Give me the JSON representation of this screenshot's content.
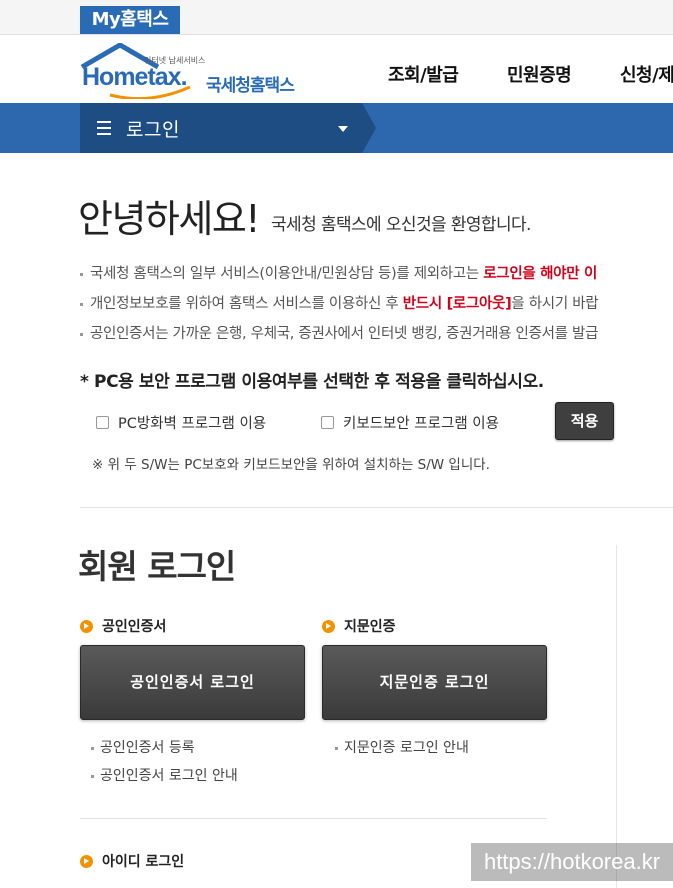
{
  "topbar": {
    "my_tab": "My홈택스"
  },
  "header": {
    "logo_tagline": "인터넷 납세서비스",
    "logo_word": "Hometax.",
    "logo_text": "국세청홈택스",
    "nav": [
      "조회/발급",
      "민원증명",
      "신청/제"
    ]
  },
  "menu": {
    "selected": "로그인"
  },
  "greeting": {
    "hello": "안녕하세요!",
    "welcome": "국세청 홈택스에 오신것을 환영합니다."
  },
  "notices": [
    {
      "pre": "국세청 홈택스의 일부 서비스(이용안내/민원상담 등)를 제외하고는 ",
      "em": "로그인을 해야만 이",
      "post": ""
    },
    {
      "pre": "개인정보보호를 위하여 홈택스 서비스를 이용하신 후 ",
      "em": "반드시 [로그아웃]",
      "post": "을 하시기 바랍"
    },
    {
      "pre": "공인인증서는 가까운 은행, 우체국, 증권사에서 인터넷 뱅킹, 증권거래용 인증서를 발급",
      "em": "",
      "post": ""
    }
  ],
  "security": {
    "instruction": "* PC용 보안 프로그램 이용여부를 선택한 후 적용을 클릭하십시오.",
    "option_firewall": "PC방화벽 프로그램 이용",
    "option_keyboard": "키보드보안 프로그램 이용",
    "apply_label": "적용",
    "note": "※ 위 두 S/W는 PC보호와 키보드보안을 위하여 설치하는 S/W 입니다."
  },
  "login": {
    "title": "회원 로그인",
    "cert": {
      "heading": "공인인증서",
      "button": "공인인증서 로그인",
      "links": [
        "공인인증서 등록",
        "공인인증서 로그인 안내"
      ]
    },
    "finger": {
      "heading": "지문인증",
      "button": "지문인증 로그인",
      "links": [
        "지문인증 로그인 안내"
      ]
    },
    "id": {
      "heading": "아이디 로그인"
    }
  },
  "watermark": "https://hotkorea.kr"
}
